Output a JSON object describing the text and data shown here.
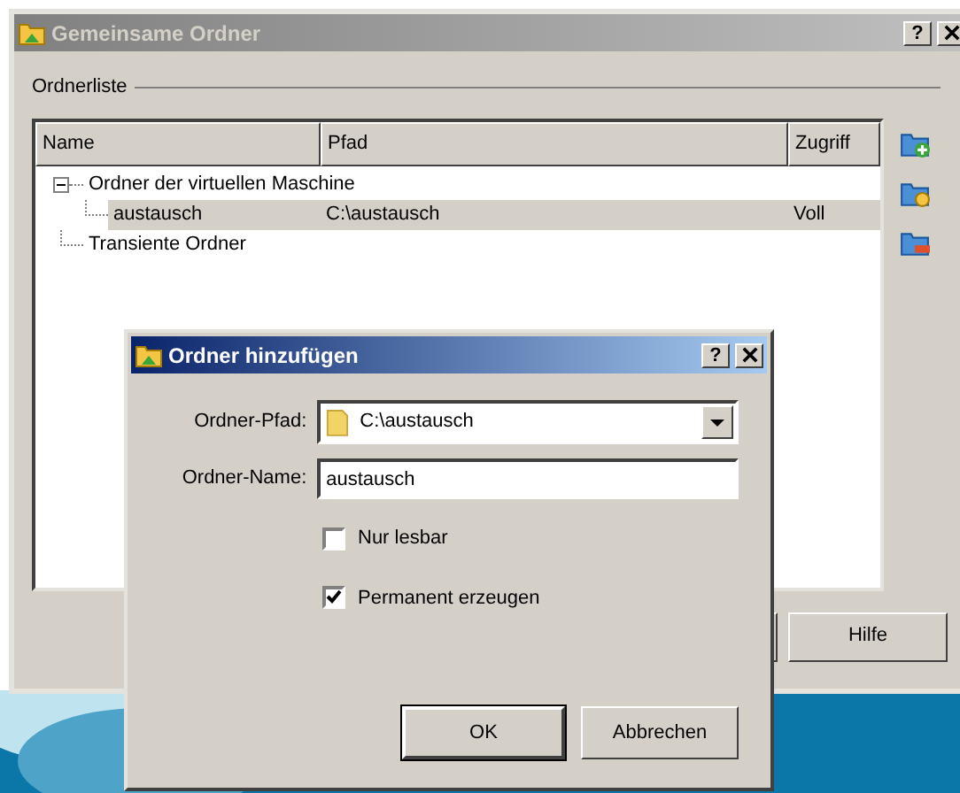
{
  "window": {
    "title": "Gemeinsame Ordner",
    "active": false,
    "title_buttons": [
      "?"
    ]
  },
  "group_label": "Ordnerliste",
  "table": {
    "columns": [
      "Name",
      "Pfad",
      "Zugriff"
    ],
    "tree": [
      {
        "name": "Ordner der virtuellen Maschine",
        "expanded": true,
        "selected": false,
        "children": [
          {
            "name": "austausch",
            "path": "C:\\austausch",
            "access": "Voll",
            "selected": true
          }
        ]
      },
      {
        "name": "Transiente Ordner",
        "selected": false
      }
    ]
  },
  "buttons": [
    {
      "label": "Hilfe"
    }
  ],
  "dialog": {
    "title": "Ordner hinzufügen",
    "active": true,
    "title_buttons": [
      "?"
    ],
    "fields": [
      {
        "kind": "combo",
        "label": "Ordner-Pfad:",
        "value": "C:\\austausch"
      },
      {
        "kind": "text",
        "label": "Ordner-Name:",
        "value": "austausch"
      }
    ],
    "checkboxes": [
      {
        "label": "Nur lesbar",
        "checked": false
      },
      {
        "label": "Permanent erzeugen",
        "checked": true
      }
    ],
    "buttons": [
      {
        "label": "OK",
        "default": true
      },
      {
        "label": "Abbrechen",
        "default": false
      }
    ]
  }
}
